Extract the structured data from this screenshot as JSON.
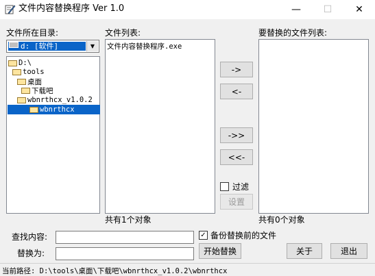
{
  "window": {
    "title": "文件内容替换程序 Ver 1.0",
    "minimize_glyph": "—",
    "maximize_glyph": "☐",
    "close_glyph": "✕"
  },
  "labels": {
    "dir": "文件所在目录:",
    "file_list": "文件列表:",
    "replace_list": "要替换的文件列表:",
    "file_count": "共有1个对象",
    "replace_count": "共有0个对象",
    "find": "查找内容:",
    "replace_with": "替换为:",
    "filter": "过滤",
    "backup": "备份替换前的文件"
  },
  "drive": {
    "selected": "d: [软件]",
    "arrow": "▼"
  },
  "tree": [
    {
      "label": "D:\\"
    },
    {
      "label": "tools"
    },
    {
      "label": "桌面"
    },
    {
      "label": "下载吧"
    },
    {
      "label": "wbnrthcx_v1.0.2"
    },
    {
      "label": "wbnrthcx"
    }
  ],
  "files": [
    "文件内容替换程序.exe"
  ],
  "buttons": {
    "move_right": "->",
    "move_left": "<-",
    "move_all_right": "->>",
    "move_all_left": "<<-",
    "settings": "设置",
    "start": "开始替换",
    "about": "关于",
    "exit": "退出"
  },
  "checkboxes": {
    "filter_checked": false,
    "backup_checked": true,
    "check_glyph": "✓"
  },
  "inputs": {
    "find_value": "",
    "replace_value": ""
  },
  "status": {
    "path": "当前路径: D:\\tools\\桌面\\下载吧\\wbnrthcx_v1.0.2\\wbnrthcx"
  },
  "colors": {
    "selection": "#0a64c8",
    "window_bg": "#f0f0f0",
    "titlebar_bg": "#ffffff"
  }
}
